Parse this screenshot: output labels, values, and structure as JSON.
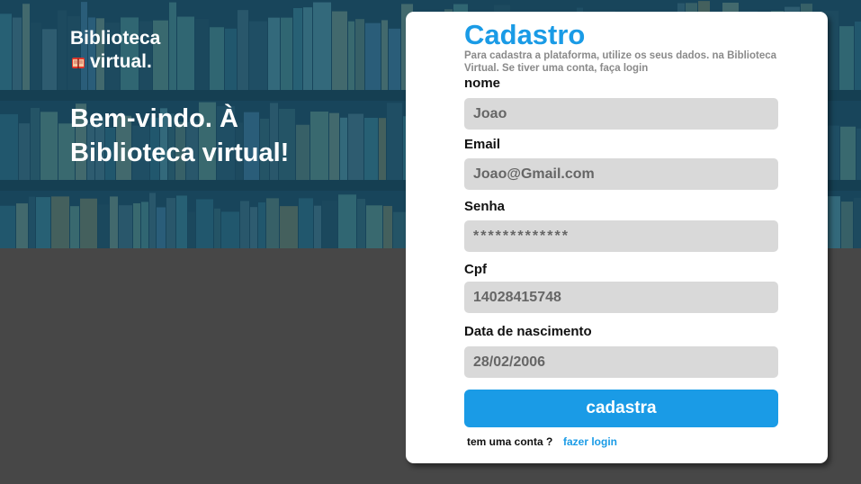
{
  "brand": {
    "line1": "Biblioteca",
    "line2": "virtual.",
    "icon": "book-icon"
  },
  "hero": {
    "welcome": "Bem-vindo. À Biblioteca virtual!"
  },
  "form": {
    "title": "Cadastro",
    "subtitle": "Para cadastra a plataforma, utilize os seus dados. na Biblioteca Virtual. Se  tiver uma conta, faça login",
    "fields": [
      {
        "label": "nome",
        "value": "Joao"
      },
      {
        "label": "Email",
        "value": "Joao@Gmail.com"
      },
      {
        "label": "Senha",
        "value": "*************"
      },
      {
        "label": "Cpf",
        "value": "14028415748"
      },
      {
        "label": "Data de nascimento",
        "value": "28/02/2006"
      }
    ],
    "submit_label": "cadastra",
    "footer_text": "tem uma conta ?",
    "login_link": "fazer login"
  },
  "colors": {
    "accent": "#1a9be6",
    "background": "#474747",
    "field": "#d9d9d9"
  }
}
